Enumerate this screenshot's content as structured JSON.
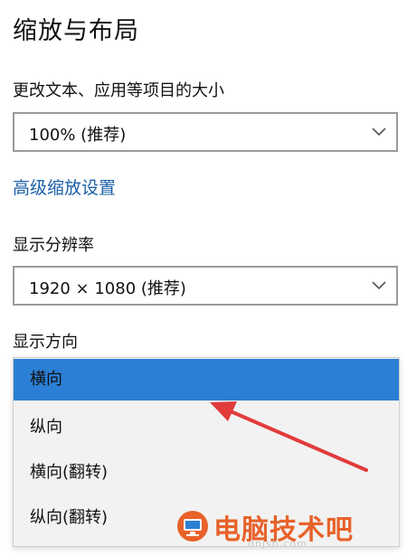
{
  "section": {
    "title": "缩放与布局"
  },
  "scale": {
    "label": "更改文本、应用等项目的大小",
    "value": "100% (推荐)"
  },
  "advanced_link": "高级缩放设置",
  "resolution": {
    "label": "显示分辨率",
    "value": "1920 × 1080 (推荐)"
  },
  "orientation": {
    "label": "显示方向",
    "options": [
      "横向",
      "纵向",
      "横向(翻转)",
      "纵向(翻转)"
    ],
    "selected": "横向"
  },
  "watermark": {
    "text": "电脑技术吧",
    "url": "dnjsb.com"
  },
  "colors": {
    "accent": "#2b7fd4",
    "link": "#1a5fa8",
    "annotation_arrow": "#e23b3b",
    "watermark": "#e8622a"
  },
  "icons": [
    "chevron-down-icon",
    "annotation-arrow",
    "watermark-logo"
  ]
}
